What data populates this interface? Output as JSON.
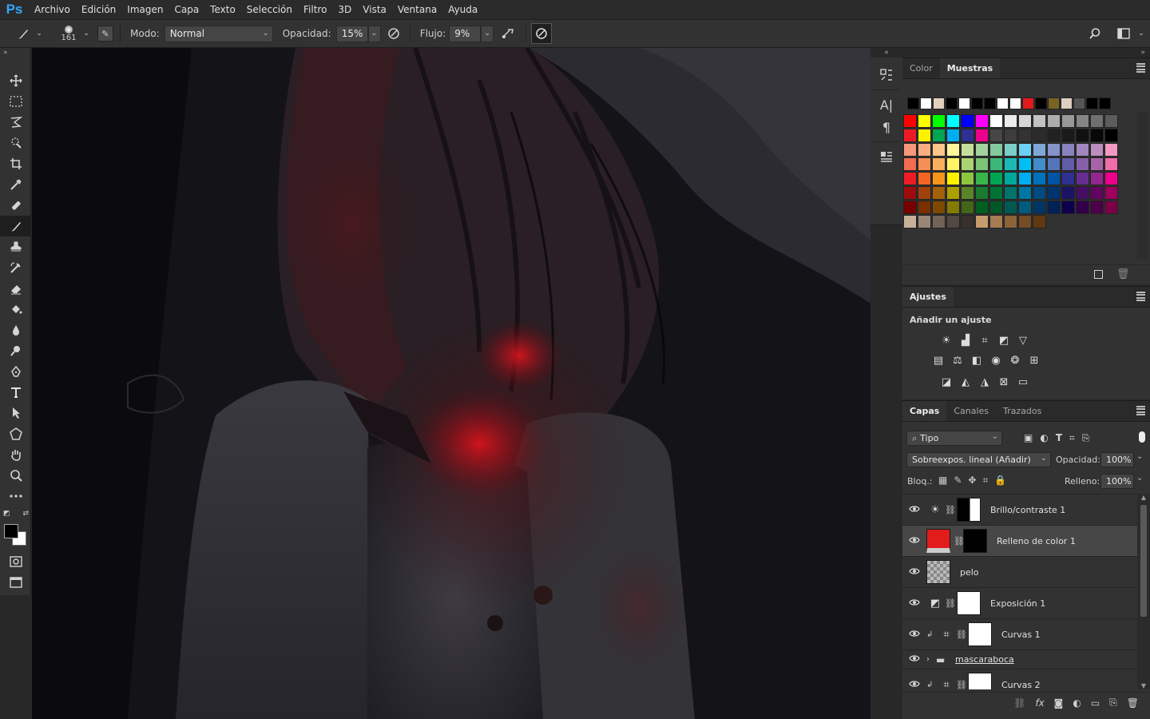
{
  "app": {
    "logo": "Ps",
    "menu": [
      "Archivo",
      "Edición",
      "Imagen",
      "Capa",
      "Texto",
      "Selección",
      "Filtro",
      "3D",
      "Vista",
      "Ventana",
      "Ayuda"
    ]
  },
  "options": {
    "brush_size": "161",
    "mode_label": "Modo:",
    "mode_value": "Normal",
    "opacity_label": "Opacidad:",
    "opacity_value": "15%",
    "flow_label": "Flujo:",
    "flow_value": "9%"
  },
  "tools": [
    "move-tool",
    "marquee-tool",
    "lasso-tool",
    "quick-selection-tool",
    "crop-tool",
    "eyedropper-tool",
    "healing-tool",
    "brush-tool",
    "stamp-tool",
    "history-brush-tool",
    "eraser-tool",
    "bucket-tool",
    "blur-tool",
    "dodge-tool",
    "pen-tool",
    "type-tool",
    "path-selection-tool",
    "shape-tool",
    "hand-tool",
    "zoom-tool",
    "more-tools"
  ],
  "active_tool": "brush-tool",
  "swatches_panel": {
    "tabs": [
      "Color",
      "Muestras"
    ],
    "active_tab": "Muestras",
    "recent": [
      "#000000",
      "#ffffff",
      "#e2d1bd",
      "#000000",
      "#ffffff",
      "#000000",
      "#000000",
      "#ffffff",
      "#ffffff",
      "#e01b1b",
      "#000000",
      "#7a6424",
      "#ddd0c0",
      "#555555",
      "#000000",
      "#000000"
    ],
    "grid": [
      [
        "#ff0000",
        "#ffff00",
        "#00ff00",
        "#00ffff",
        "#0000ff",
        "#ff00ff",
        "#ffffff",
        "#ebebeb",
        "#d6d6d6",
        "#c2c2c2",
        "#adadad",
        "#999999",
        "#858585",
        "#707070",
        "#5c5c5c"
      ],
      [
        "#ed1c24",
        "#fff200",
        "#00a651",
        "#00aeef",
        "#2e3192",
        "#ec008c",
        "#474747",
        "#3d3d3d",
        "#333333",
        "#2b2b2b",
        "#222222",
        "#1a1a1a",
        "#111111",
        "#080808",
        "#000000"
      ],
      [
        "#f7977a",
        "#f9ad81",
        "#fdc68a",
        "#fff799",
        "#c4df9b",
        "#a3d39c",
        "#82ca9d",
        "#7bcdc8",
        "#6ecff6",
        "#7ea7d8",
        "#8493ca",
        "#8882be",
        "#a187be",
        "#bc8dbf",
        "#f49ac2"
      ],
      [
        "#f26c4f",
        "#f68e55",
        "#fbaf5c",
        "#fff467",
        "#acd372",
        "#7cc576",
        "#3bb878",
        "#1abbb4",
        "#00bff3",
        "#438ccb",
        "#5574b9",
        "#605ca8",
        "#855fa8",
        "#a763a8",
        "#f06ea9"
      ],
      [
        "#ed1c24",
        "#f26522",
        "#f7941d",
        "#fff200",
        "#8dc73f",
        "#39b54a",
        "#00a651",
        "#00a99d",
        "#00aeef",
        "#0072bc",
        "#0054a6",
        "#2e3192",
        "#662d91",
        "#92278f",
        "#ec008c"
      ],
      [
        "#9e0b0f",
        "#a0410d",
        "#a36209",
        "#aba000",
        "#598527",
        "#1a7b30",
        "#007236",
        "#00746b",
        "#0076a3",
        "#004b80",
        "#003471",
        "#1b1464",
        "#440e62",
        "#630460",
        "#9e005d"
      ],
      [
        "#790000",
        "#7b2e00",
        "#7d4900",
        "#827b00",
        "#406618",
        "#005e20",
        "#005826",
        "#005952",
        "#005b7f",
        "#003663",
        "#002157",
        "#0d004c",
        "#32004b",
        "#4b0049",
        "#7b0046"
      ],
      [
        "#c7b299",
        "#998675",
        "#736357",
        "#534741",
        "#37302d",
        "#c69c6d",
        "#a67c52",
        "#8c6239",
        "#754c24",
        "#603913"
      ]
    ]
  },
  "adjustments_panel": {
    "title": "Ajustes",
    "subtitle": "Añadir un ajuste",
    "row1": [
      "brightness-icon",
      "levels-icon",
      "curves-icon",
      "exposure-icon",
      "vibrance-icon"
    ],
    "row2": [
      "hue-saturation-icon",
      "color-balance-icon",
      "black-white-icon",
      "photo-filter-icon",
      "channel-mixer-icon",
      "color-lookup-icon"
    ],
    "row3": [
      "invert-icon",
      "posterize-icon",
      "threshold-icon",
      "selective-color-icon",
      "gradient-map-icon"
    ]
  },
  "layers_panel": {
    "tabs": [
      "Capas",
      "Canales",
      "Trazados"
    ],
    "active_tab": "Capas",
    "filter_value": "Tipo",
    "blend_value": "Sobreexpos. lineal (Añadir)",
    "opacity_label": "Opacidad:",
    "opacity_value": "100%",
    "lock_label": "Bloq.:",
    "fill_label": "Relleno:",
    "fill_value": "100%",
    "layers": [
      {
        "name": "Brillo/contraste 1",
        "type": "adjustment",
        "icon": "brightness-icon",
        "selected": false,
        "clipped": false
      },
      {
        "name": "Relleno de color 1",
        "type": "fill",
        "selected": true,
        "clipped": false
      },
      {
        "name": "pelo",
        "type": "pixel",
        "selected": false,
        "clipped": false
      },
      {
        "name": "Exposición 1",
        "type": "adjustment",
        "icon": "exposure-icon",
        "selected": false,
        "clipped": false
      },
      {
        "name": "Curvas 1",
        "type": "adjustment",
        "icon": "curves-icon",
        "selected": false,
        "clipped": true
      },
      {
        "name": "mascaraboca",
        "type": "group",
        "selected": false,
        "clipped": false
      },
      {
        "name": "Curvas 2",
        "type": "adjustment",
        "icon": "curves-icon",
        "selected": false,
        "clipped": true
      }
    ]
  },
  "colors": {
    "accent": "#31a8ff",
    "fill_red": "#e21b1b",
    "foreground": "#000000",
    "background": "#ffffff"
  }
}
